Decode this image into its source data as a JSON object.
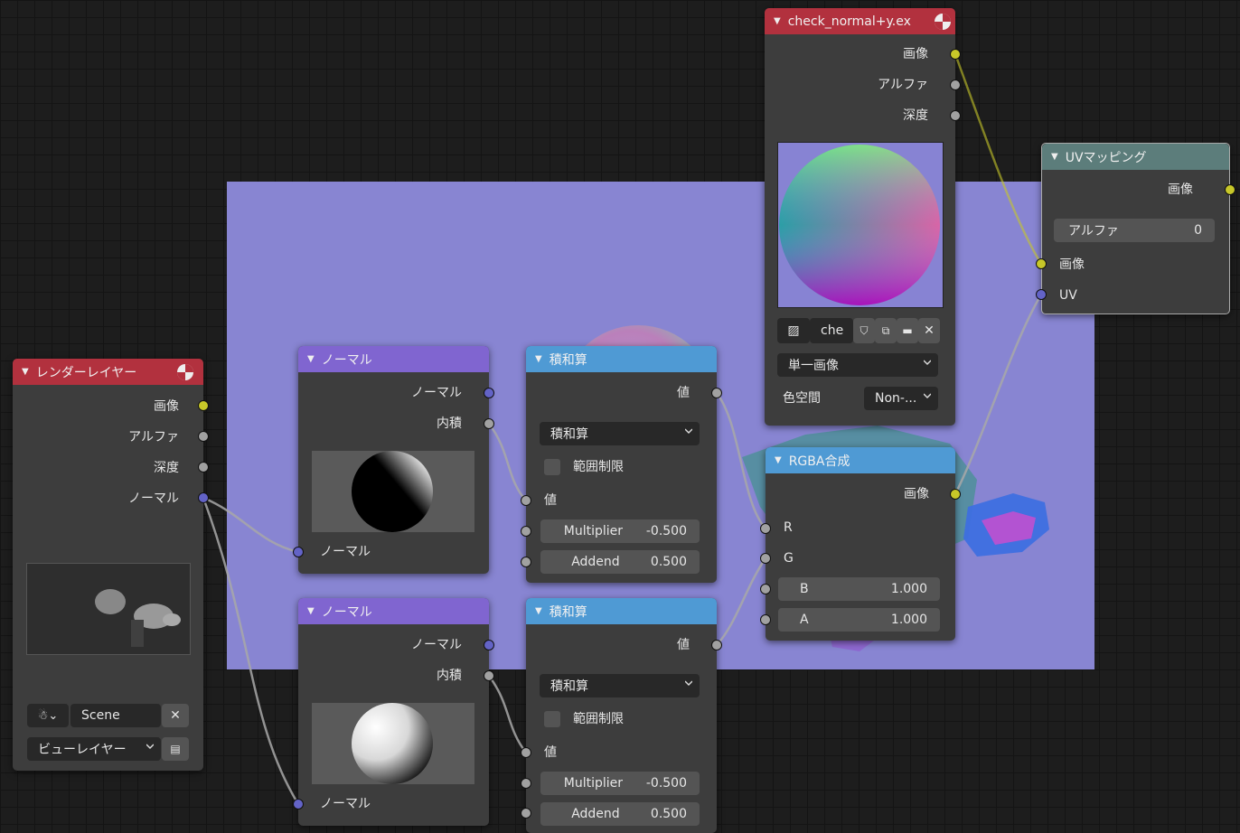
{
  "nodes": {
    "render_layers": {
      "title": "レンダーレイヤー",
      "outputs": [
        "画像",
        "アルファ",
        "深度",
        "ノーマル"
      ],
      "scene": "Scene",
      "view_layer": "ビューレイヤー"
    },
    "normal_top": {
      "title": "ノーマル",
      "outputs": [
        "ノーマル",
        "内積"
      ],
      "input": "ノーマル"
    },
    "normal_bottom": {
      "title": "ノーマル",
      "outputs": [
        "ノーマル",
        "内積"
      ],
      "input": "ノーマル"
    },
    "muladd_top": {
      "title": "積和算",
      "output": "値",
      "operation": "積和算",
      "clamp_label": "範囲制限",
      "input_value": "値",
      "multiplier_label": "Multiplier",
      "multiplier": "-0.500",
      "addend_label": "Addend",
      "addend": "0.500"
    },
    "muladd_bottom": {
      "title": "積和算",
      "output": "値",
      "operation": "積和算",
      "clamp_label": "範囲制限",
      "input_value": "値",
      "multiplier_label": "Multiplier",
      "multiplier": "-0.500",
      "addend_label": "Addend",
      "addend": "0.500"
    },
    "image": {
      "title": "check_normal+y.ex",
      "outputs": [
        "画像",
        "アルファ",
        "深度"
      ],
      "image_name": "che",
      "source": "単一画像",
      "colorspace_label": "色空間",
      "colorspace": "Non-..."
    },
    "combine_rgba": {
      "title": "RGBA合成",
      "output": "画像",
      "r": "R",
      "g": "G",
      "b_label": "B",
      "b": "1.000",
      "a_label": "A",
      "a": "1.000"
    },
    "uv_map": {
      "title": "UVマッピング",
      "output": "画像",
      "alpha_label": "アルファ",
      "alpha": "0",
      "input_image": "画像",
      "input_uv": "UV"
    }
  },
  "colors": {
    "socket_color": "#c7c729",
    "socket_float": "#a1a1a1",
    "socket_vector": "#6363c7",
    "header_input": "#b2313e",
    "header_vector": "#8065d0",
    "header_converter": "#4f9ad4",
    "header_distort": "#5c7d7b",
    "backdrop": "#8885d2"
  }
}
